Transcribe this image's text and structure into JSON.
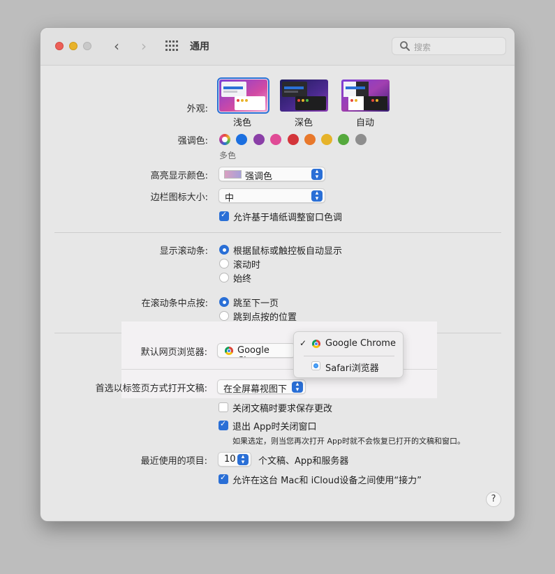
{
  "window": {
    "title": "通用",
    "search_placeholder": "搜索"
  },
  "appearance": {
    "label": "外观:",
    "options": [
      {
        "name": "浅色",
        "selected": true
      },
      {
        "name": "深色",
        "selected": false
      },
      {
        "name": "自动",
        "selected": false
      }
    ]
  },
  "accent": {
    "label": "强调色:",
    "caption": "多色",
    "colors": [
      "multicolor",
      "#1b6fe0",
      "#8a3fa7",
      "#e04b96",
      "#d3353a",
      "#e8782b",
      "#e6b32a",
      "#55a93d",
      "#8e8e8e"
    ]
  },
  "highlight_color": {
    "label": "高亮显示颜色:",
    "value": "强调色"
  },
  "sidebar_icon_size": {
    "label": "边栏图标大小:",
    "value": "中"
  },
  "wallpaper_tint": {
    "label": "允许基于墙纸调整窗口色调",
    "checked": true
  },
  "show_scrollbars": {
    "label": "显示滚动条:",
    "options": [
      {
        "label": "根据鼠标或触控板自动显示",
        "selected": true
      },
      {
        "label": "滚动时",
        "selected": false
      },
      {
        "label": "始终",
        "selected": false
      }
    ]
  },
  "click_scrollbar": {
    "label": "在滚动条中点按:",
    "options": [
      {
        "label": "跳至下一页",
        "selected": true
      },
      {
        "label": "跳到点按的位置",
        "selected": false
      }
    ]
  },
  "default_browser": {
    "label": "默认网页浏览器:",
    "value": "Google Chrome",
    "value_visible": "Google Chrom",
    "menu": [
      {
        "label": "Google Chrome",
        "checked": true,
        "icon": "chrome-icon"
      },
      {
        "label": "Safari浏览器",
        "checked": false,
        "icon": "safari-icon"
      }
    ]
  },
  "prefer_tabs": {
    "label": "首选以标签页方式打开文稿:",
    "value": "在全屏幕视图下"
  },
  "ask_keep_changes": {
    "label": "关闭文稿时要求保存更改",
    "checked": false
  },
  "close_windows": {
    "label": "退出 App时关闭窗口",
    "checked": true,
    "note": "如果选定，则当您再次打开 App时就不会恢复已打开的文稿和窗口。"
  },
  "recent_items": {
    "label": "最近使用的项目:",
    "value": "10",
    "suffix": "个文稿、App和服务器"
  },
  "handoff": {
    "label": "允许在这台 Mac和 iCloud设备之间使用“接力”",
    "checked": true
  },
  "help": {
    "label": "?"
  }
}
